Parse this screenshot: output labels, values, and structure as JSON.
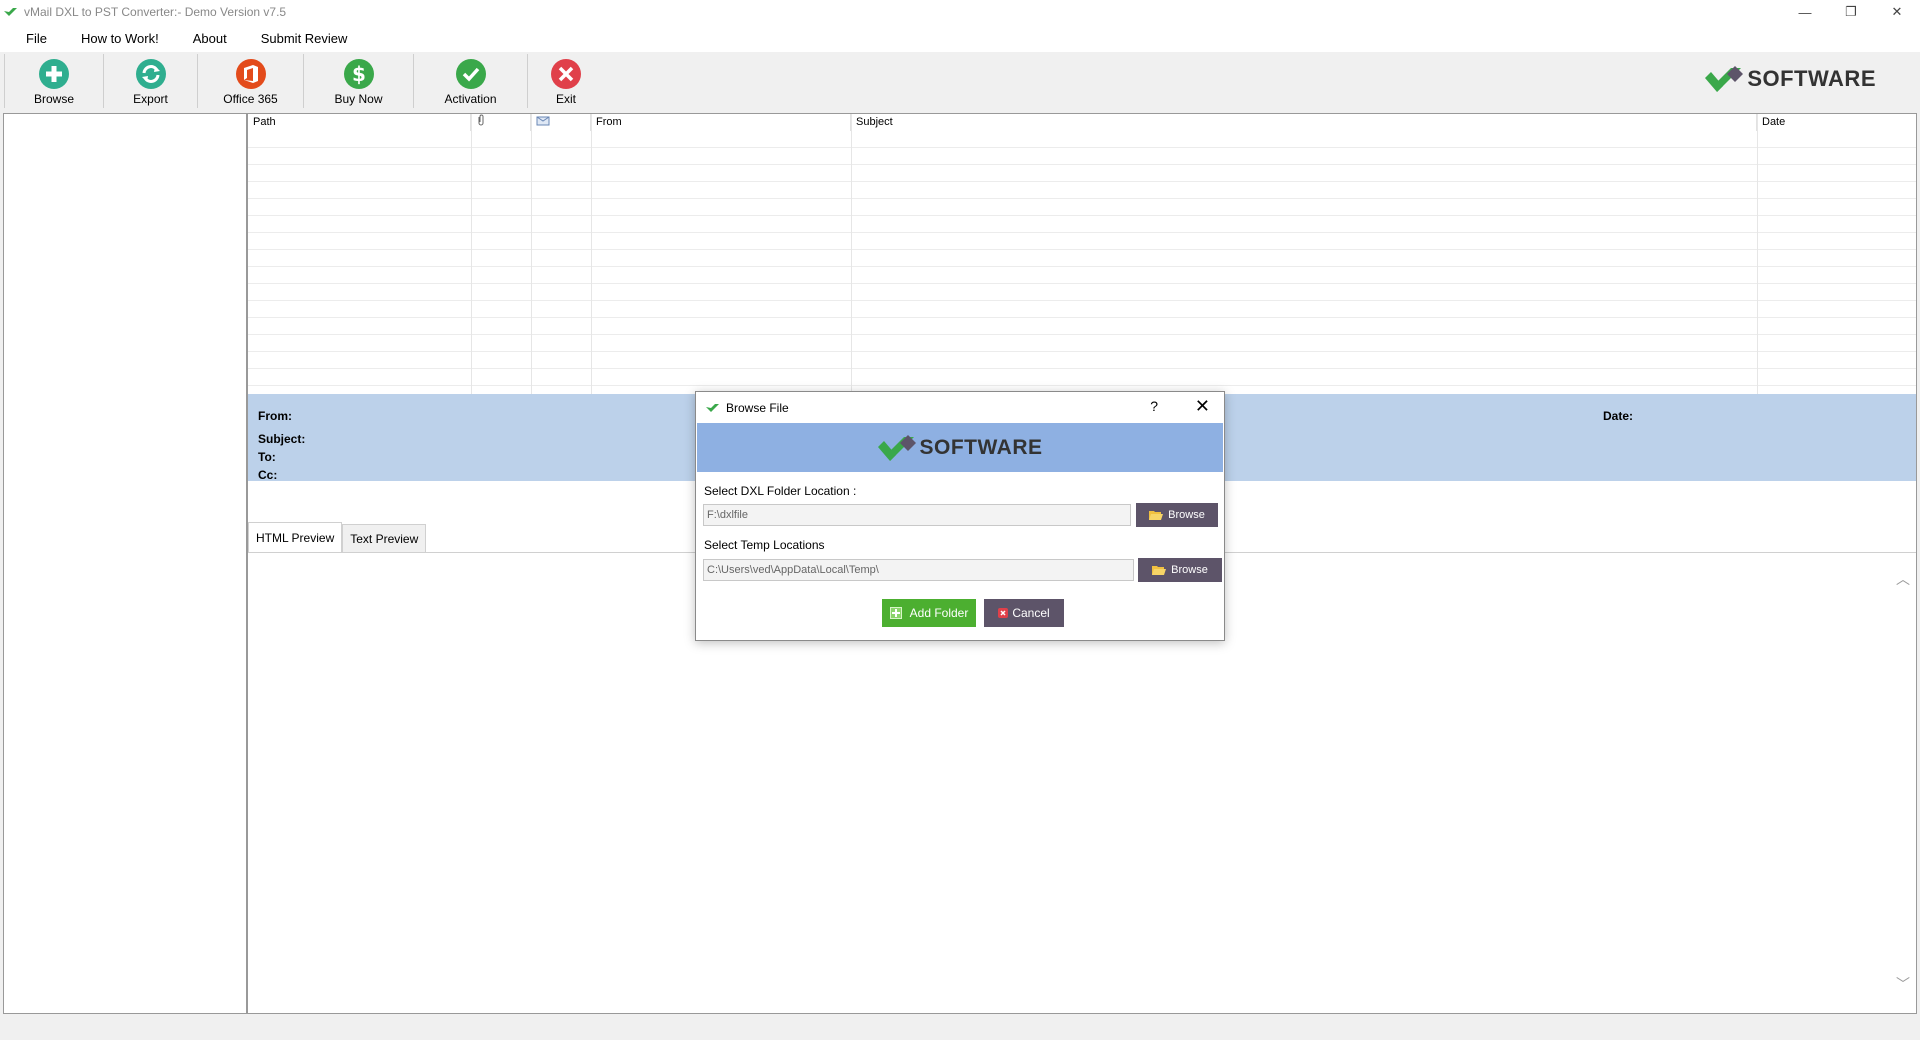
{
  "window": {
    "title": "vMail DXL to PST Converter:- Demo Version v7.5",
    "minimize": "—",
    "restore": "❐",
    "close": "✕"
  },
  "menu": [
    "File",
    "How to Work!",
    "About",
    "Submit Review"
  ],
  "toolbar": {
    "buttons": [
      {
        "label": "Browse",
        "icon": "plus-icon",
        "color": "#2fae8f"
      },
      {
        "label": "Export",
        "icon": "refresh-icon",
        "color": "#2fae8f"
      },
      {
        "label": "Office 365",
        "icon": "office-icon",
        "color": "#e34b1b"
      },
      {
        "label": "Buy Now",
        "icon": "dollar-icon",
        "color": "#3aa84a"
      },
      {
        "label": "Activation",
        "icon": "check-icon",
        "color": "#3aa84a"
      },
      {
        "label": "Exit",
        "icon": "close-icon",
        "color": "#e0404a"
      }
    ],
    "logo_text": "SOFTWARE"
  },
  "grid": {
    "columns": [
      "Path",
      "",
      "",
      "From",
      "Subject",
      "Date"
    ],
    "column_icons": [
      "",
      "attachment-icon",
      "envelope-icon",
      "",
      "",
      ""
    ]
  },
  "info": {
    "from_label": "From:",
    "subject_label": "Subject:",
    "to_label": "To:",
    "cc_label": "Cc:",
    "date_label": "Date:"
  },
  "tabs": [
    "HTML Preview",
    "Text Preview"
  ],
  "dialog": {
    "title": "Browse File",
    "help": "?",
    "close": "✕",
    "logo_text": "SOFTWARE",
    "dxl_label": "Select DXL Folder Location :",
    "dxl_value": "F:\\dxlfile",
    "temp_label": "Select Temp Locations",
    "temp_value": "C:\\Users\\ved\\AppData\\Local\\Temp\\",
    "browse_label": "Browse",
    "add_label": "Add Folder",
    "cancel_label": "Cancel"
  },
  "colors": {
    "accent_green": "#4caf30",
    "dialog_button": "#5d5469",
    "header_band": "#bcd1ea",
    "dialog_banner": "#8eb0e2"
  }
}
